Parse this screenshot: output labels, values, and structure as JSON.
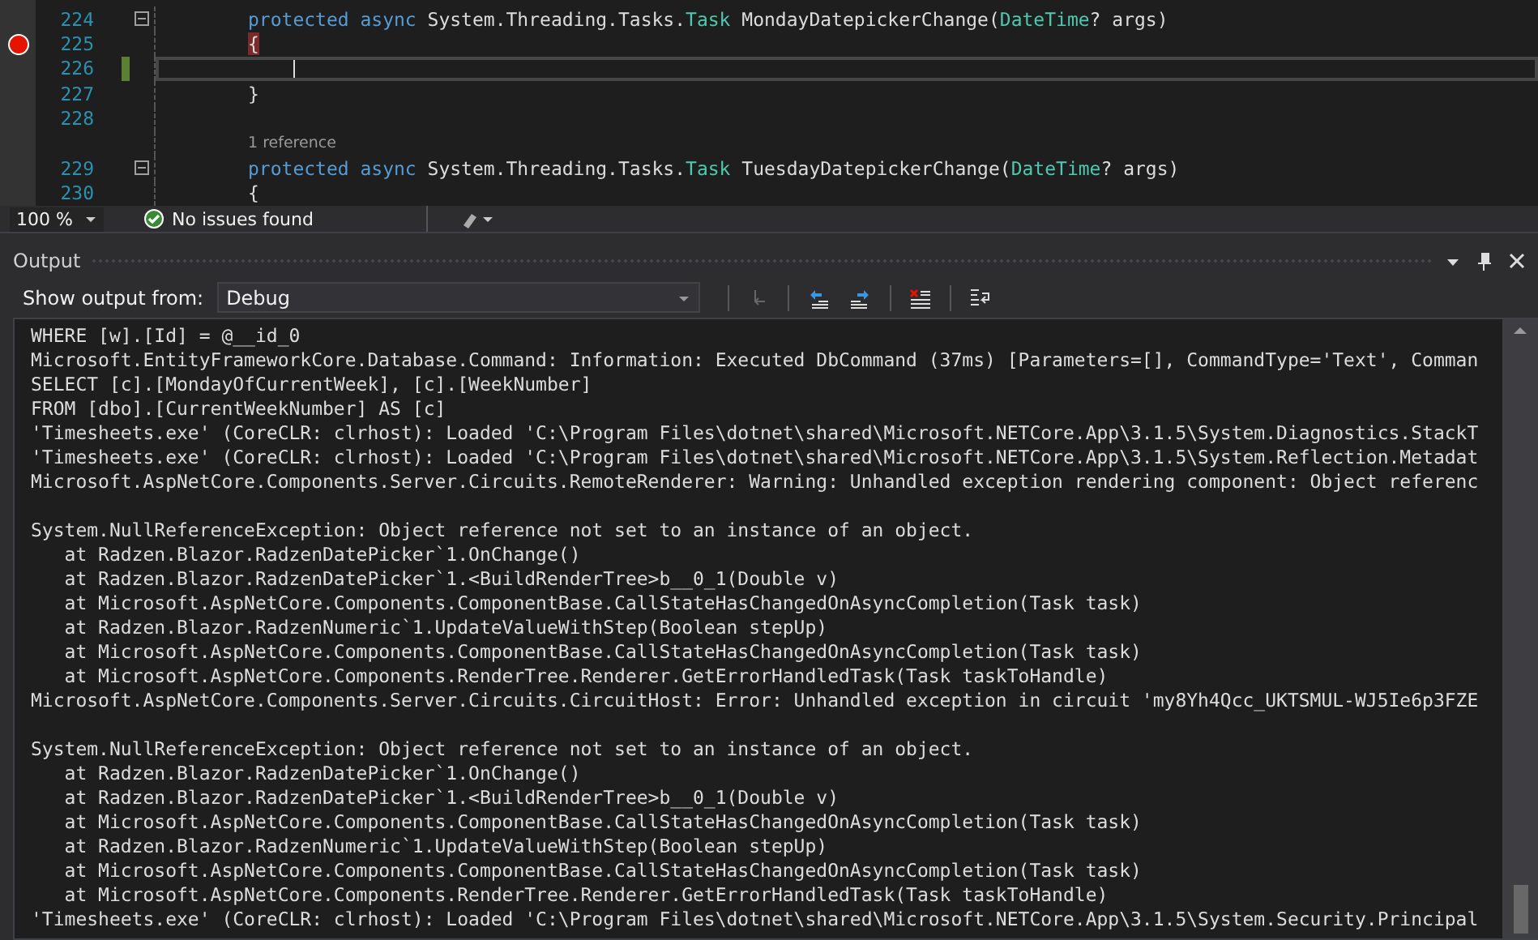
{
  "editor": {
    "lines": [
      {
        "number": "224",
        "breakpoint": false,
        "changed": false,
        "current": false,
        "fold": true,
        "tokens": [
          {
            "text": "protected",
            "kind": "keyword"
          },
          {
            "text": " async",
            "kind": "keyword"
          },
          {
            "text": " System.Threading.Tasks.",
            "kind": "plain"
          },
          {
            "text": "Task",
            "kind": "type"
          },
          {
            "text": " MondayDatepickerChange(",
            "kind": "plain"
          },
          {
            "text": "DateTime",
            "kind": "type"
          },
          {
            "text": "? args)",
            "kind": "plain"
          }
        ]
      },
      {
        "number": "225",
        "breakpoint": true,
        "changed": false,
        "current": false,
        "fold": false,
        "tokens": [
          {
            "text": "{",
            "kind": "bp"
          }
        ]
      },
      {
        "number": "226",
        "breakpoint": false,
        "changed": true,
        "current": true,
        "fold": false
      },
      {
        "number": "227",
        "breakpoint": false,
        "changed": false,
        "current": false,
        "fold": false,
        "tokens": [
          {
            "text": "}",
            "kind": "plain"
          }
        ]
      },
      {
        "number": "228",
        "breakpoint": false,
        "changed": false,
        "current": false,
        "fold": false
      },
      {
        "lens": "1 reference",
        "number": "229",
        "breakpoint": false,
        "changed": false,
        "current": false,
        "fold": true,
        "tokens": [
          {
            "text": "protected",
            "kind": "keyword"
          },
          {
            "text": " async",
            "kind": "keyword"
          },
          {
            "text": " System.Threading.Tasks.",
            "kind": "plain"
          },
          {
            "text": "Task",
            "kind": "type"
          },
          {
            "text": " TuesdayDatepickerChange(",
            "kind": "plain"
          },
          {
            "text": "DateTime",
            "kind": "type"
          },
          {
            "text": "? args)",
            "kind": "plain"
          }
        ]
      },
      {
        "number": "230",
        "breakpoint": false,
        "changed": false,
        "current": false,
        "fold": false,
        "tokens": [
          {
            "text": "{",
            "kind": "plain"
          }
        ]
      }
    ]
  },
  "status_bar": {
    "zoom": "100 %",
    "issues": "No issues found"
  },
  "output": {
    "title": "Output",
    "source_label": "Show output from:",
    "source": "Debug",
    "blocks": [
      [
        "WHERE [w].[Id] = @__id_0",
        "Microsoft.EntityFrameworkCore.Database.Command: Information: Executed DbCommand (37ms) [Parameters=[], CommandType='Text', Comman",
        "SELECT [c].[MondayOfCurrentWeek], [c].[WeekNumber]",
        "FROM [dbo].[CurrentWeekNumber] AS [c]",
        "'Timesheets.exe' (CoreCLR: clrhost): Loaded 'C:\\Program Files\\dotnet\\shared\\Microsoft.NETCore.App\\3.1.5\\System.Diagnostics.StackT",
        "'Timesheets.exe' (CoreCLR: clrhost): Loaded 'C:\\Program Files\\dotnet\\shared\\Microsoft.NETCore.App\\3.1.5\\System.Reflection.Metadat",
        "Microsoft.AspNetCore.Components.Server.Circuits.RemoteRenderer: Warning: Unhandled exception rendering component: Object referenc"
      ],
      [
        "System.NullReferenceException: Object reference not set to an instance of an object.",
        "   at Radzen.Blazor.RadzenDatePicker`1.OnChange()",
        "   at Radzen.Blazor.RadzenDatePicker`1.<BuildRenderTree>b__0_1(Double v)",
        "   at Microsoft.AspNetCore.Components.ComponentBase.CallStateHasChangedOnAsyncCompletion(Task task)",
        "   at Radzen.Blazor.RadzenNumeric`1.UpdateValueWithStep(Boolean stepUp)",
        "   at Microsoft.AspNetCore.Components.ComponentBase.CallStateHasChangedOnAsyncCompletion(Task task)",
        "   at Microsoft.AspNetCore.Components.RenderTree.Renderer.GetErrorHandledTask(Task taskToHandle)",
        "Microsoft.AspNetCore.Components.Server.Circuits.CircuitHost: Error: Unhandled exception in circuit 'my8Yh4Qcc_UKTSMUL-WJ5Ie6p3FZE"
      ],
      [
        "System.NullReferenceException: Object reference not set to an instance of an object.",
        "   at Radzen.Blazor.RadzenDatePicker`1.OnChange()",
        "   at Radzen.Blazor.RadzenDatePicker`1.<BuildRenderTree>b__0_1(Double v)",
        "   at Microsoft.AspNetCore.Components.ComponentBase.CallStateHasChangedOnAsyncCompletion(Task task)",
        "   at Radzen.Blazor.RadzenNumeric`1.UpdateValueWithStep(Boolean stepUp)",
        "   at Microsoft.AspNetCore.Components.ComponentBase.CallStateHasChangedOnAsyncCompletion(Task task)",
        "   at Microsoft.AspNetCore.Components.RenderTree.Renderer.GetErrorHandledTask(Task taskToHandle)",
        "'Timesheets.exe' (CoreCLR: clrhost): Loaded 'C:\\Program Files\\dotnet\\shared\\Microsoft.NETCore.App\\3.1.5\\System.Security.Principal"
      ]
    ]
  }
}
